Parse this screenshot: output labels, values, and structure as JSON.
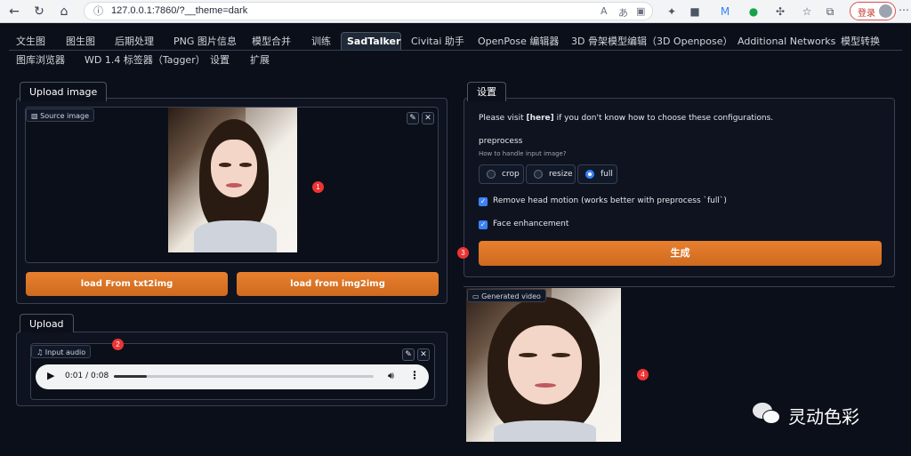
{
  "browser": {
    "url": "127.0.0.1:7860/?__theme=dark",
    "login_label": "登录"
  },
  "tabs_row1": [
    "文生图",
    "图生图",
    "后期处理",
    "PNG 图片信息",
    "模型合并",
    "训练",
    "SadTalker",
    "Civitai 助手",
    "OpenPose 编辑器",
    "3D 骨架模型编辑（3D Openpose）",
    "Additional Networks",
    "模型转换"
  ],
  "tabs_row2": [
    "图库浏览器",
    "WD 1.4 标签器（Tagger）",
    "设置",
    "扩展"
  ],
  "active_tab": "SadTalker",
  "left": {
    "upload_image_tab": "Upload image",
    "source_image_label": "Source image",
    "load_txt2img": "load From txt2img",
    "load_img2img": "load from img2img",
    "upload_tab": "Upload",
    "input_audio_label": "Input audio",
    "audio_time": "0:01 / 0:08",
    "audio_progress": 0.125
  },
  "right": {
    "settings_tab": "设置",
    "visit_prefix": "Please visit ",
    "visit_link": "[here]",
    "visit_suffix": " if you don't know how to choose these configurations.",
    "preprocess_label": "preprocess",
    "preprocess_hint": "How to handle input image?",
    "preprocess_options": [
      "crop",
      "resize",
      "full"
    ],
    "preprocess_selected": "full",
    "remove_head_motion": "Remove head motion (works better with preprocess `full`)",
    "face_enhancement": "Face enhancement",
    "generate_label": "生成",
    "generated_video_label": "Generated video"
  },
  "markers": [
    "1",
    "2",
    "3",
    "4"
  ],
  "watermark": "灵动色彩",
  "colors": {
    "accent_orange": "#e77f2e",
    "accent_blue": "#3b82f6",
    "background": "#0b0f19"
  }
}
